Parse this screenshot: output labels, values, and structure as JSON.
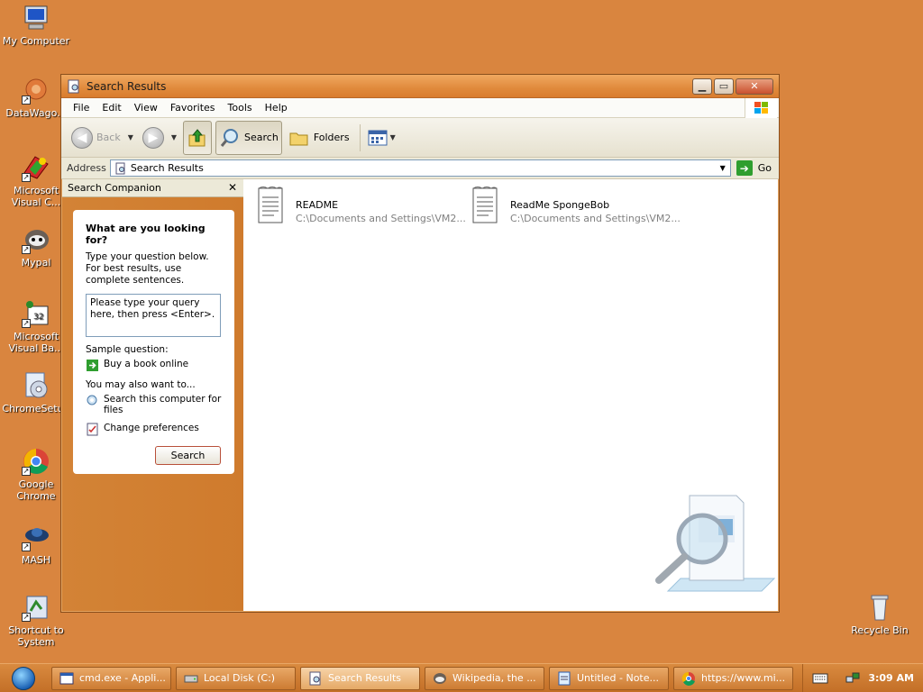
{
  "desktop": {
    "icons": [
      {
        "label": "My Computer",
        "icon": "computer-icon"
      },
      {
        "label": "DataWago...",
        "icon": "datawagon-icon"
      },
      {
        "label": "Microsoft Visual C...",
        "icon": "visual-c-icon"
      },
      {
        "label": "Mypal",
        "icon": "mypal-icon"
      },
      {
        "label": "Microsoft Visual Ba...",
        "icon": "visual-basic-icon"
      },
      {
        "label": "ChromeSetup",
        "icon": "chrome-setup-icon"
      },
      {
        "label": "Google Chrome",
        "icon": "chrome-icon"
      },
      {
        "label": "MASH",
        "icon": "mash-icon"
      },
      {
        "label": "Shortcut to System",
        "icon": "system-shortcut-icon"
      },
      {
        "label": "Recycle Bin",
        "icon": "recycle-bin-icon"
      }
    ]
  },
  "window": {
    "title": "Search Results",
    "menu": [
      "File",
      "Edit",
      "View",
      "Favorites",
      "Tools",
      "Help"
    ],
    "toolbar": {
      "back": "Back",
      "search": "Search",
      "folders": "Folders"
    },
    "address": {
      "label": "Address",
      "value": "Search Results",
      "go": "Go"
    },
    "companion": {
      "header": "Search Companion",
      "heading": "What are you looking for?",
      "description": "Type your question below. For best results, use complete sentences.",
      "query_placeholder": "Please type your query here, then press <Enter>.",
      "sample_label": "Sample question:",
      "sample_link": "Buy a book online",
      "also_label": "You may also want to...",
      "link_search_computer": "Search this computer for files",
      "link_preferences": "Change preferences",
      "search_button": "Search"
    },
    "files": [
      {
        "name": "README",
        "path": "C:\\Documents and Settings\\VM2..."
      },
      {
        "name": "ReadMe SpongeBob",
        "path": "C:\\Documents and Settings\\VM2..."
      }
    ]
  },
  "taskbar": {
    "tasks": [
      {
        "label": "cmd.exe - Appli...",
        "icon": "cmd-icon"
      },
      {
        "label": "Local Disk (C:)",
        "icon": "drive-icon"
      },
      {
        "label": "Search Results",
        "icon": "search-results-icon",
        "active": true
      },
      {
        "label": "Wikipedia, the ...",
        "icon": "mypal-icon"
      },
      {
        "label": "Untitled - Note...",
        "icon": "notepad-icon"
      },
      {
        "label": "https://www.mi...",
        "icon": "chrome-icon"
      }
    ],
    "clock": "3:09 AM"
  }
}
